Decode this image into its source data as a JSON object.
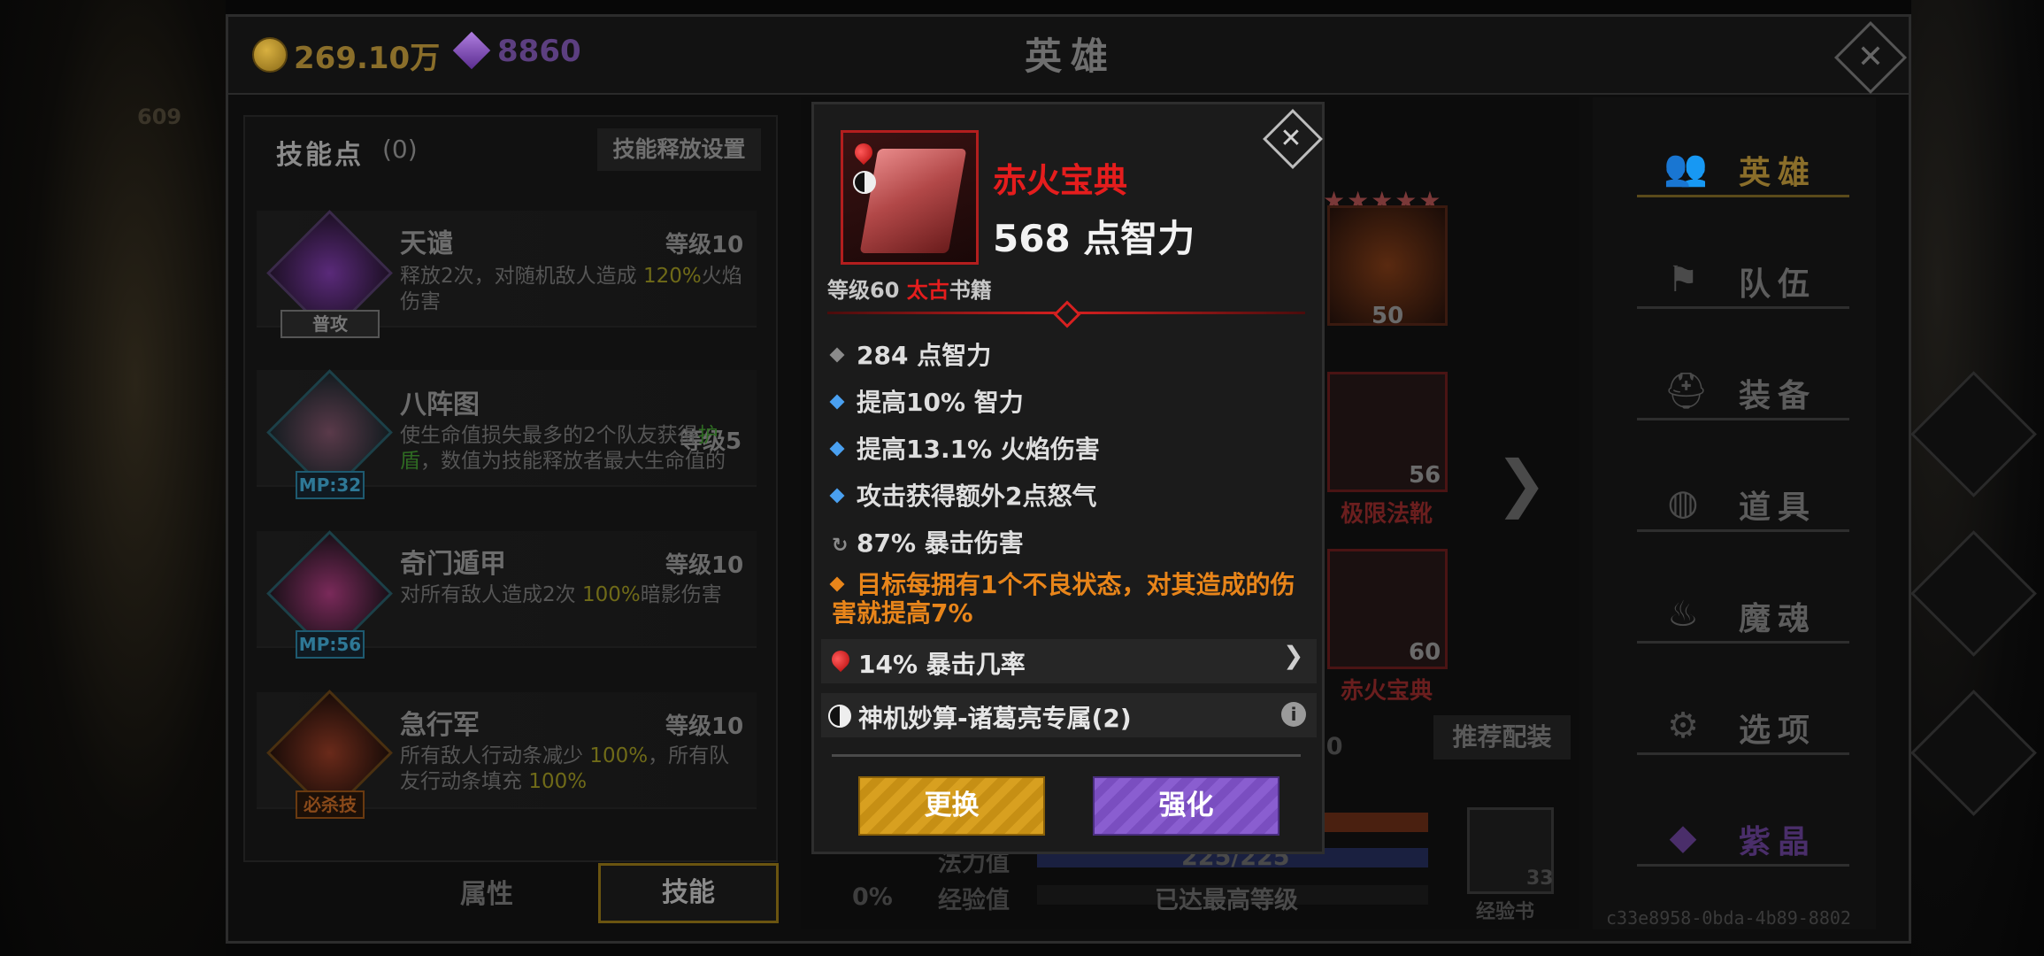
{
  "header": {
    "gold": "269.10万",
    "gems": "8860",
    "title": "英雄",
    "close_symbol": "✕"
  },
  "background": {
    "ghost_number": "609",
    "ghost_code": "c33e8958-0bda-4b89-8802"
  },
  "skills_panel": {
    "points_label": "技能点",
    "points_count": "(0)",
    "release_settings": "技能释放设置",
    "skills": [
      {
        "name": "天谴",
        "level": "等级10",
        "tag": "普攻",
        "desc": [
          "释放2次，对随机敌人造成 ",
          "120%",
          "火焰伤害"
        ]
      },
      {
        "name": "八阵图",
        "level": "等级5",
        "tag": "MP:32",
        "desc": [
          "使生命值损失最多的2个队友获得",
          "护盾",
          "，数值为技能释放者最大生命值的"
        ]
      },
      {
        "name": "奇门遁甲",
        "level": "等级10",
        "tag": "MP:56",
        "desc": [
          "对所有敌人造成2次 ",
          "100%",
          "暗影伤害"
        ]
      },
      {
        "name": "急行军",
        "level": "等级10",
        "tag": "必杀技",
        "desc": [
          "所有敌人行动条减少 ",
          "100%",
          "，所有队友行动条填充 ",
          "100%"
        ]
      }
    ],
    "tab_attributes": "属性",
    "tab_skills": "技能"
  },
  "hero_area": {
    "stars": "★★★★★",
    "slots": [
      {
        "num": "50",
        "name": ""
      },
      {
        "num": "56",
        "name": "极限法靴"
      },
      {
        "num": "60",
        "name": "赤火宝典"
      }
    ],
    "arrow": "❯",
    "recommend": "推荐配装",
    "mana_label": "法力值",
    "mana_value": "225/225",
    "exp_label": "经验值",
    "exp_value": "已达最高等级",
    "percent": "0%",
    "left_num": "50",
    "exp_book_label": "经验书",
    "exp_book_count": "33"
  },
  "nav": {
    "items": [
      {
        "label": "英雄",
        "icon": "heroes-icon",
        "glyph": "👥",
        "active": true
      },
      {
        "label": "队伍",
        "icon": "flag-icon",
        "glyph": "⚑",
        "active": false
      },
      {
        "label": "装备",
        "icon": "helmet-icon",
        "glyph": "⛑",
        "active": false
      },
      {
        "label": "道具",
        "icon": "bag-icon",
        "glyph": "◍",
        "active": false
      },
      {
        "label": "魔魂",
        "icon": "flame-icon",
        "glyph": "♨",
        "active": false
      },
      {
        "label": "选项",
        "icon": "gear-icon",
        "glyph": "⚙",
        "active": false
      },
      {
        "label": "紫晶",
        "icon": "crystal-icon",
        "glyph": "◆",
        "active": false
      }
    ]
  },
  "popup": {
    "item_name": "赤火宝典",
    "main_stat": "568 点智力",
    "level_prefix": "等级60 ",
    "rarity": "太古",
    "category": "书籍",
    "stats": [
      {
        "text": "284 点智力",
        "bullet_color": "#8a8a8a"
      },
      {
        "text": "提高10% 智力",
        "bullet_color": "#4aa0f0"
      },
      {
        "text": "提高13.1% 火焰伤害",
        "bullet_color": "#4aa0f0"
      },
      {
        "text": "攻击获得额外2点怒气",
        "bullet_color": "#4aa0f0"
      },
      {
        "text": "87% 暴击伤害",
        "bullet_color": "#8a8a8a"
      }
    ],
    "legendary_stat": "目标每拥有1个不良状态，对其造成的伤害就提高7%",
    "socket_gem": "14% 暴击几率",
    "set_bonus": "神机妙算-诸葛亮专属(2)",
    "replace_button": "更换",
    "enhance_button": "强化",
    "close_symbol": "✕",
    "info_symbol": "i",
    "chevron": "❯"
  },
  "colors": {
    "accent_red": "#e51d1d",
    "legendary_orange": "#e8851a",
    "replace_gold": "#d8a020",
    "enhance_purple": "#8a5ed0"
  }
}
